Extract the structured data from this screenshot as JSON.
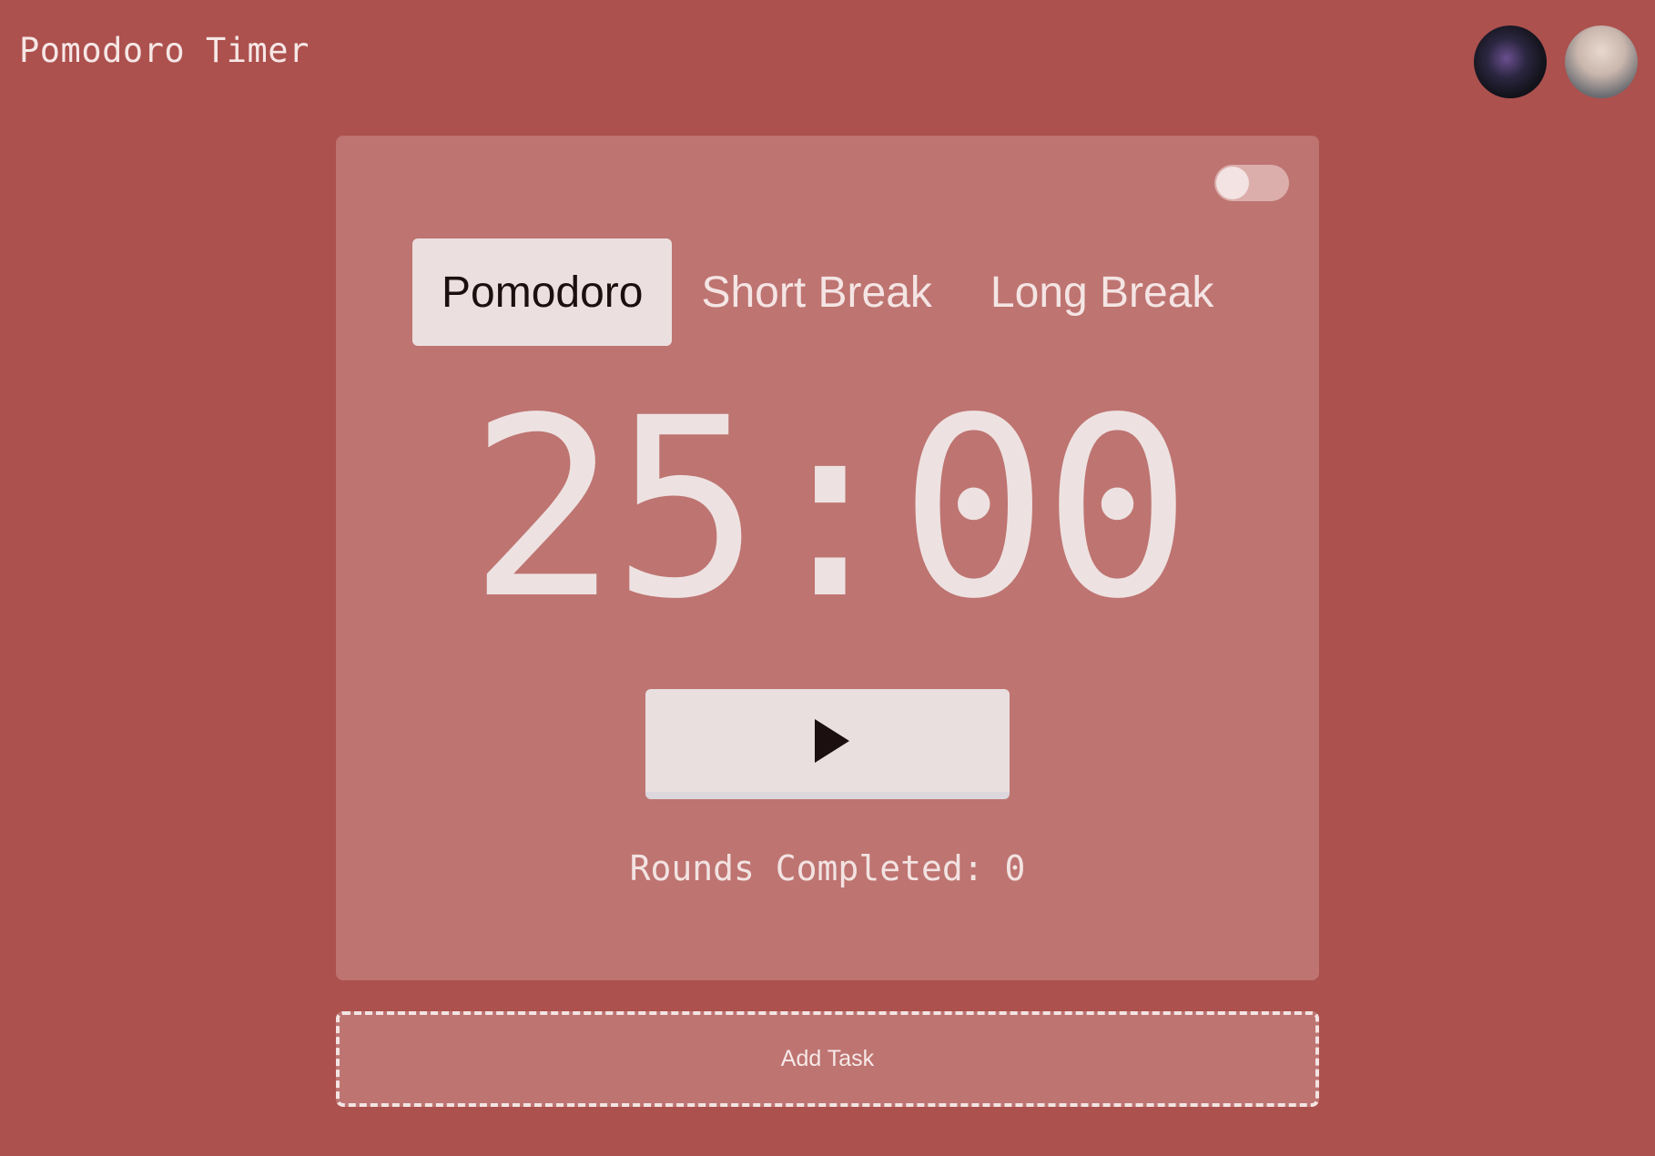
{
  "header": {
    "title": "Pomodoro Timer"
  },
  "avatars": [
    {
      "name": "avatar-dark-flower"
    },
    {
      "name": "avatar-user-photo"
    }
  ],
  "timer_card": {
    "toggle_state": "off",
    "tabs": [
      {
        "label": "Pomodoro",
        "active": true
      },
      {
        "label": "Short Break",
        "active": false
      },
      {
        "label": "Long Break",
        "active": false
      }
    ],
    "time": "25:00",
    "play_icon": "play-icon",
    "rounds_label": "Rounds Completed: 0"
  },
  "add_task": {
    "label": "Add Task"
  },
  "colors": {
    "background": "#ac514e",
    "card": "#be7471",
    "active_tab": "#ebe0df",
    "text_light": "#f4e5e4"
  }
}
